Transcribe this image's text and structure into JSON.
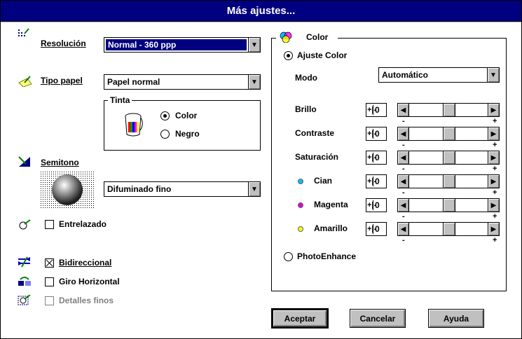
{
  "window": {
    "title": "Más ajustes..."
  },
  "left": {
    "resolution": {
      "label": "Resolución",
      "value": "Normal - 360 ppp"
    },
    "paper": {
      "label": "Tipo papel",
      "value": "Papel normal"
    },
    "ink": {
      "title": "Tinta",
      "color_label": "Color",
      "black_label": "Negro",
      "selected": "Color"
    },
    "halftone": {
      "label": "Semitono",
      "value": "Difuminado fino"
    },
    "interleave": {
      "label": "Entrelazado",
      "checked": false
    },
    "bidirectional": {
      "label": "Bidireccional",
      "checked": true
    },
    "flip": {
      "label": "Giro Horizontal",
      "checked": false
    },
    "fine": {
      "label": "Detalles finos",
      "checked": false,
      "enabled": false
    }
  },
  "color": {
    "title": "Color",
    "adjust_label": "Ajuste Color",
    "mode_label": "Modo",
    "mode_value": "Automático",
    "photo_label": "PhotoEnhance",
    "selected": "Ajuste Color",
    "sliders": [
      {
        "label": "Brillo",
        "sign": "+|-",
        "value": "0",
        "minus": "-",
        "plus": "+",
        "level": 0.5
      },
      {
        "label": "Contraste",
        "sign": "+|-",
        "value": "0",
        "minus": "-",
        "plus": "+",
        "level": 0.5
      },
      {
        "label": "Saturación",
        "sign": "+|-",
        "value": "0",
        "minus": "-",
        "plus": "+",
        "level": 0.5
      },
      {
        "label": "Cian",
        "sign": "+|-",
        "value": "0",
        "minus": "-",
        "plus": "+",
        "level": 0.5,
        "dot": "#00c0ff"
      },
      {
        "label": "Magenta",
        "sign": "+|-",
        "value": "0",
        "minus": "-",
        "plus": "+",
        "level": 0.5,
        "dot": "#e000e0"
      },
      {
        "label": "Amarillo",
        "sign": "+|-",
        "value": "0",
        "minus": "-",
        "plus": "+",
        "level": 0.5,
        "dot": "#ffff00"
      }
    ]
  },
  "buttons": {
    "ok": "Aceptar",
    "cancel": "Cancelar",
    "help": "Ayuda"
  },
  "colors": {
    "titlebar": "#000080",
    "face": "#c0c0c0"
  },
  "icons": {
    "resolution": "resolution-icon",
    "paper": "paper-icon",
    "ink": "ink-bucket-icon",
    "halftone": "halftone-icon",
    "interleave": "interleave-icon",
    "bidirectional": "bidirectional-icon",
    "flip": "flip-icon",
    "fine": "fine-detail-icon",
    "color": "color-circles-icon",
    "dropdown": "chevron-down-icon"
  }
}
